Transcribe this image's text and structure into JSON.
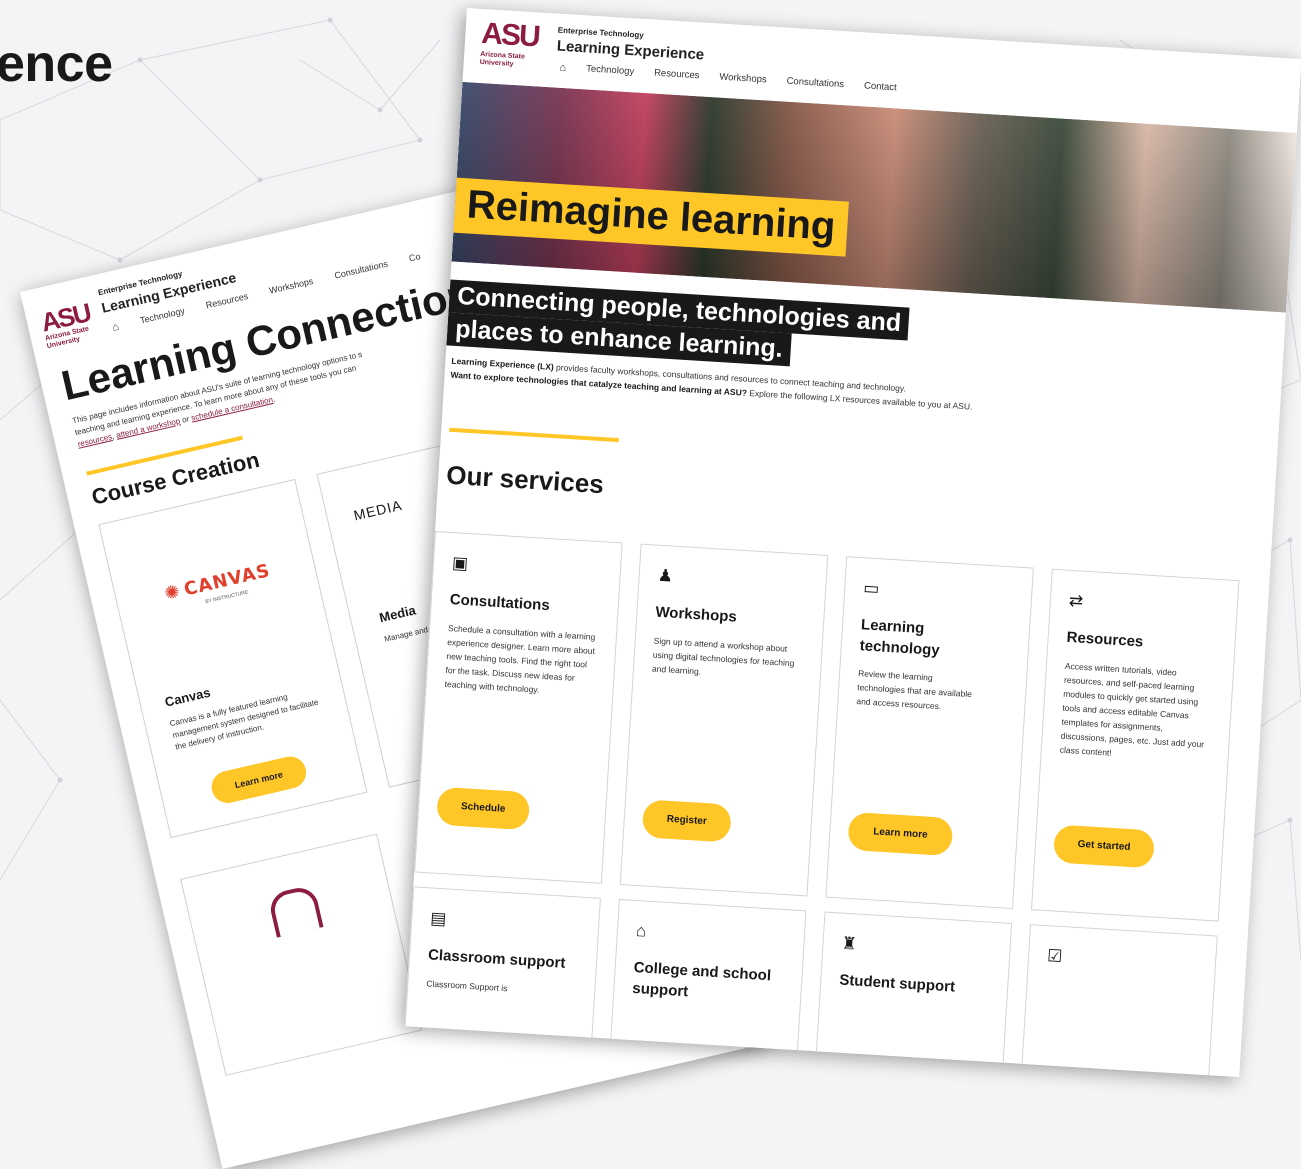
{
  "slide": {
    "title_fragment": "ence"
  },
  "back_page": {
    "logo": "ASU",
    "logo_sub": [
      "Arizona State",
      "University"
    ],
    "header_small": "Enterprise Technology",
    "site_name": "Learning Experience",
    "nav": [
      "Technology",
      "Resources",
      "Workshops",
      "Consultations",
      "Co"
    ],
    "page_title": "Learning Connections",
    "intro": {
      "line1": "This page includes information about ASU's suite of learning technology options to s",
      "line2": "teaching and learning experience. To learn more about any of these tools you can",
      "link_resources": "resources",
      "sep1": ", ",
      "link_workshop": "attend a workshop",
      "sep2": " or ",
      "link_consultation": "schedule a consultation",
      "end": "."
    },
    "section_title": "Course Creation",
    "cards": [
      {
        "logo_text": "CANVAS",
        "logo_tagline": "BY INSTRUCTURE",
        "title": "Canvas",
        "body": "Canvas is a fully featured learning management system designed to facilitate the delivery of instruction.",
        "button": "Learn more"
      },
      {
        "logo_text": "MEDIA",
        "title": "Media",
        "body": "Manage and s"
      }
    ]
  },
  "front_page": {
    "logo": "ASU",
    "logo_sub": [
      "Arizona State",
      "University"
    ],
    "header_small": "Enterprise Technology",
    "site_name": "Learning Experience",
    "nav": [
      "Technology",
      "Resources",
      "Workshops",
      "Consultations",
      "Contact"
    ],
    "hero_title": "Reimagine learning",
    "tagline": [
      "Connecting people, technologies and",
      "places to enhance learning."
    ],
    "intro_bold_1": "Learning Experience (LX)",
    "intro_text_1": " provides faculty workshops, consultations and resources to connect teaching and technology.",
    "intro_bold_2": "Want to explore technologies that catalyze teaching and learning at ASU?",
    "intro_text_2": " Explore the following LX resources available to you at ASU.",
    "services_title": "Our services",
    "services": [
      {
        "icon": "address-book-icon",
        "glyph": "▣",
        "title": "Consultations",
        "body": "Schedule a consultation with a learning experience designer. Learn more about new teaching tools. Find the right tool for the task. Discuss new ideas for teaching with technology.",
        "button": "Schedule"
      },
      {
        "icon": "chalkboard-teacher-icon",
        "glyph": "♟",
        "title": "Workshops",
        "body": "Sign up to attend a workshop about using digital technologies for teaching and learning.",
        "button": "Register"
      },
      {
        "icon": "desktop-icon",
        "glyph": "▭",
        "title": "Learning technology",
        "body": "Review the learning technologies that are available and access resources.",
        "button": "Learn more"
      },
      {
        "icon": "people-arrows-icon",
        "glyph": "⇄",
        "title": "Resources",
        "body": "Access written tutorials, video resources, and self-paced learning modules to quickly get started using tools and access editable Canvas templates for assignments, discussions, pages, etc. Just add your class content!",
        "button": "Get started"
      }
    ],
    "services_row2": [
      {
        "icon": "chalkboard-icon",
        "glyph": "▤",
        "title": "Classroom support",
        "body": "Classroom Support is"
      },
      {
        "icon": "university-icon",
        "glyph": "⌂",
        "title": "College and school support"
      },
      {
        "icon": "graduation-cap-icon",
        "glyph": "♜",
        "title": "Student support"
      },
      {
        "icon": "check-square-icon",
        "glyph": "☑",
        "title": ""
      }
    ]
  },
  "colors": {
    "maroon": "#8c1d40",
    "gold": "#ffc627",
    "dark": "#191919",
    "canvas_red": "#e13e2b"
  }
}
